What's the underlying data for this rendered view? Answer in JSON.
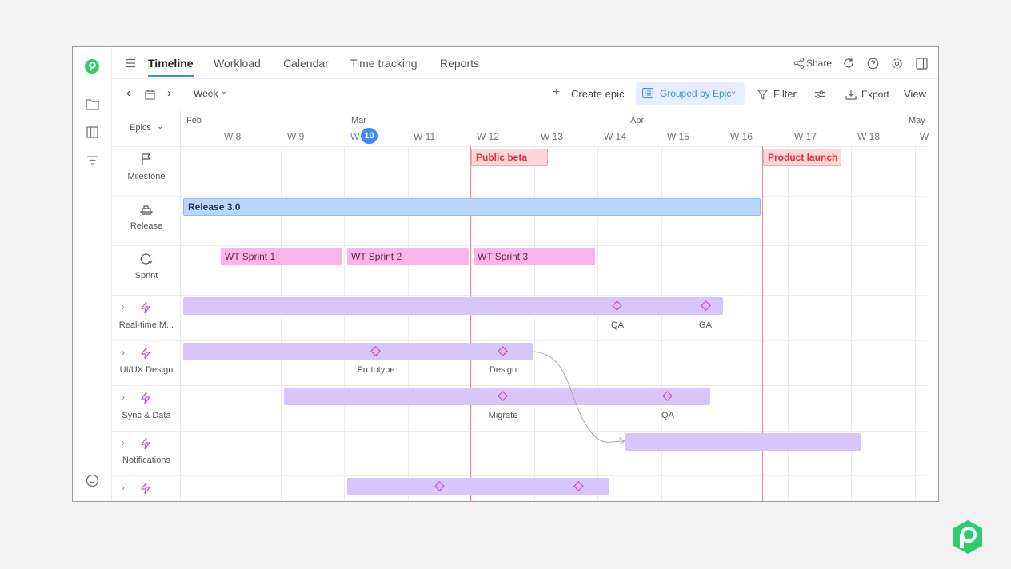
{
  "nav": {
    "tabs": [
      {
        "label": "Timeline",
        "active": true
      },
      {
        "label": "Workload"
      },
      {
        "label": "Calendar"
      },
      {
        "label": "Time tracking"
      },
      {
        "label": "Reports"
      }
    ],
    "share_label": "Share"
  },
  "toolbar": {
    "range_label": "Week",
    "create_epic_label": "Create epic",
    "grouped_label": "Grouped by Epic",
    "filter_label": "Filter",
    "export_label": "Export",
    "view_label": "View"
  },
  "header": {
    "epics_label": "Epics",
    "months": [
      "Feb",
      "Mar",
      "Apr",
      "May"
    ],
    "weeks": [
      "W 8",
      "W 9",
      "W",
      "W 11",
      "W 12",
      "W 13",
      "W 14",
      "W 15",
      "W 16",
      "W 17",
      "W 18",
      "W"
    ],
    "current_week_badge": "10"
  },
  "rows": {
    "milestone": "Milestone",
    "release": "Release",
    "sprint": "Sprint",
    "epics": [
      "Real-time M...",
      "UI/UX Design",
      "Sync & Data",
      "Notifications",
      ""
    ]
  },
  "bars": {
    "release": "Release 3.0",
    "sprints": [
      "WT Sprint 1",
      "WT Sprint 2",
      "WT Sprint 3"
    ],
    "milestones": [
      "Public beta",
      "Product launch"
    ],
    "epic_milestones": {
      "realtime": [
        "QA",
        "GA"
      ],
      "uiux": [
        "Prototype",
        "Design"
      ],
      "sync": [
        "Migrate",
        "QA"
      ]
    }
  },
  "colors": {
    "accent": "#3f8cf5",
    "release": "#bcd5fb",
    "sprint": "#fdb4e8",
    "epic": "#d7c5fb",
    "milestone": "#e0303d",
    "brand": "#2ecc71"
  }
}
